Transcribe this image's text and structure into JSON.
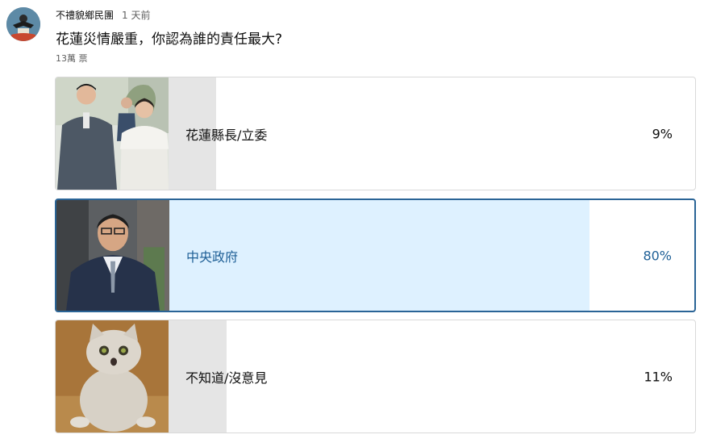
{
  "post": {
    "author": "不禮貌鄉民團",
    "time": "1 天前",
    "question": "花蓮災情嚴重，你認為誰的責任最大?",
    "votes": "13萬 票"
  },
  "options": [
    {
      "label": "花蓮縣長/立委",
      "percent_text": "9%",
      "percent": 9,
      "selected": false,
      "image": "two-people-photo"
    },
    {
      "label": "中央政府",
      "percent_text": "80%",
      "percent": 80,
      "selected": true,
      "image": "man-in-suit-photo"
    },
    {
      "label": "不知道/沒意見",
      "percent_text": "11%",
      "percent": 11,
      "selected": false,
      "image": "surprised-cat-photo"
    }
  ],
  "colors": {
    "selected_border": "#2a6496",
    "selected_fill": "#def1ff",
    "selected_text": "#1e5f96",
    "unselected_fill": "#e5e5e5"
  }
}
